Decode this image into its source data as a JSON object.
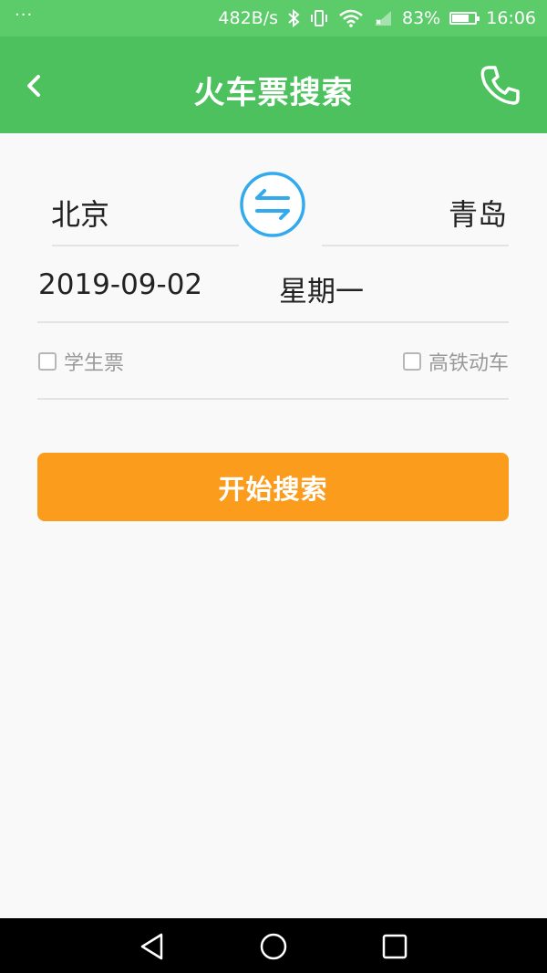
{
  "status_bar": {
    "left_indicator": "···",
    "net_speed": "482B/s",
    "battery": "83%",
    "battery_level": 0.83,
    "time": "16:06",
    "icons": [
      "bluetooth-icon",
      "vibrate-icon",
      "wifi-icon",
      "signal-icon",
      "battery-icon"
    ]
  },
  "app_bar": {
    "title": "火车票搜索",
    "back_icon": "chevron-left-icon",
    "phone_icon": "phone-icon",
    "color": "#4cc15d"
  },
  "form": {
    "from_city": "北京",
    "to_city": "青岛",
    "swap_icon": "swap-arrows-icon",
    "date": "2019-09-02",
    "weekday": "星期一",
    "options": [
      {
        "label": "学生票",
        "checked": false
      },
      {
        "label": "高铁动车",
        "checked": false
      }
    ],
    "search_button": "开始搜索",
    "accent": "#fb9c1c",
    "swap_color": "#33aaee"
  },
  "nav_bar": {
    "icons": [
      "back-triangle-icon",
      "home-circle-icon",
      "recents-square-icon"
    ]
  }
}
